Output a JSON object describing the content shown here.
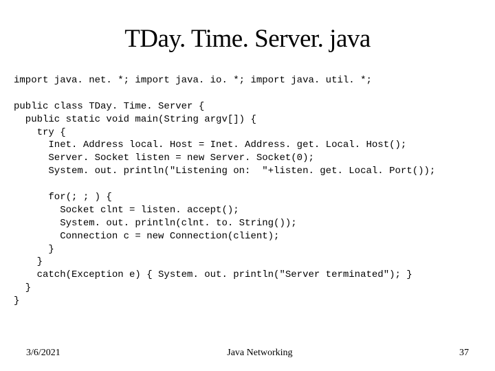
{
  "title": "TDay. Time. Server. java",
  "code": "import java. net. *; import java. io. *; import java. util. *;\n\npublic class TDay. Time. Server {\n  public static void main(String argv[]) {\n    try {\n      Inet. Address local. Host = Inet. Address. get. Local. Host();\n      Server. Socket listen = new Server. Socket(0);\n      System. out. println(\"Listening on:  \"+listen. get. Local. Port());\n\n      for(; ; ) {\n        Socket clnt = listen. accept();\n        System. out. println(clnt. to. String());\n        Connection c = new Connection(client);\n      }\n    }\n    catch(Exception e) { System. out. println(\"Server terminated\"); }\n  }\n}",
  "footer": {
    "date": "3/6/2021",
    "center": "Java Networking",
    "page": "37"
  }
}
